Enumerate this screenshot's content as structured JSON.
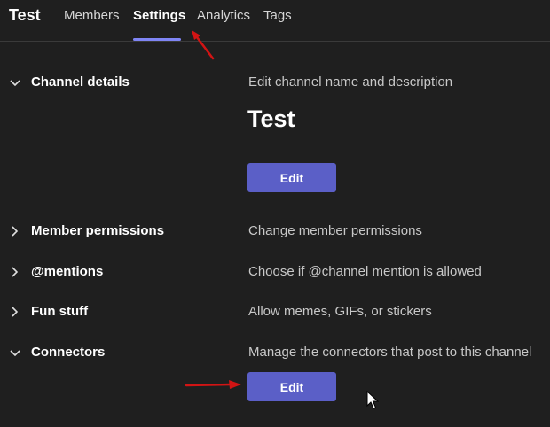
{
  "header": {
    "title": "Test",
    "tabs": [
      {
        "label": "Members",
        "active": false
      },
      {
        "label": "Settings",
        "active": true
      },
      {
        "label": "Analytics",
        "active": false
      },
      {
        "label": "Tags",
        "active": false
      }
    ]
  },
  "sections": {
    "channel_details": {
      "title": "Channel details",
      "description": "Edit channel name and description",
      "channel_name": "Test",
      "button_label": "Edit",
      "expanded": true
    },
    "member_permissions": {
      "title": "Member permissions",
      "description": "Change member permissions",
      "expanded": false
    },
    "mentions": {
      "title": "@mentions",
      "description": "Choose if @channel mention is allowed",
      "expanded": false
    },
    "fun_stuff": {
      "title": "Fun stuff",
      "description": "Allow memes, GIFs, or stickers",
      "expanded": false
    },
    "connectors": {
      "title": "Connectors",
      "description": "Manage the connectors that post to this channel",
      "button_label": "Edit",
      "expanded": true
    }
  },
  "colors": {
    "background": "#1f1f1f",
    "accent": "#5b5fc7",
    "tab_underline": "#7f85f5",
    "annotation_arrow": "#d21414"
  },
  "icons": {
    "expanded": "chevron-down-icon",
    "collapsed": "chevron-right-icon",
    "cursor": "mouse-pointer-icon",
    "annotation": "red-arrow-icon"
  }
}
